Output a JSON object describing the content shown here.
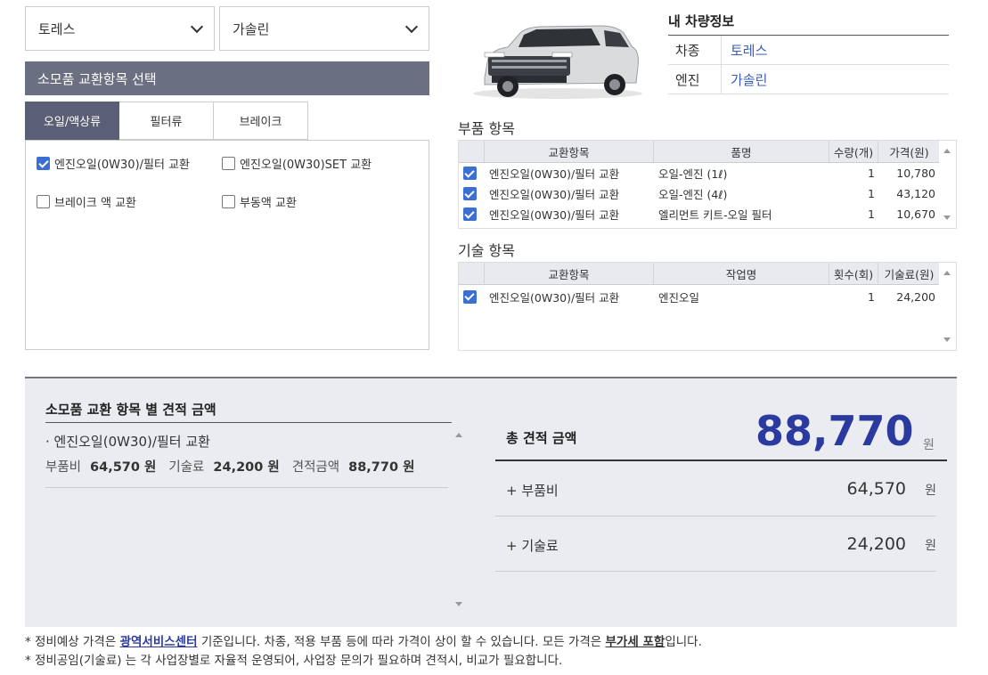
{
  "selects": {
    "car_model": "토레스",
    "fuel": "가솔린"
  },
  "consumables": {
    "header": "소모품 교환항목 선택",
    "tabs": [
      "오일/액상류",
      "필터류",
      "브레이크"
    ],
    "active_tab": 0,
    "options": [
      {
        "label": "엔진오일(0W30)/필터 교환",
        "checked": true
      },
      {
        "label": "엔진오일(0W30)SET 교환",
        "checked": false
      },
      {
        "label": "브레이크 액 교환",
        "checked": false
      },
      {
        "label": "부동액 교환",
        "checked": false
      }
    ]
  },
  "vehicle": {
    "title": "내 차량정보",
    "rows": [
      {
        "key": "차종",
        "value": "토레스"
      },
      {
        "key": "엔진",
        "value": "가솔린"
      }
    ]
  },
  "parts": {
    "title": "부품 항목",
    "headers": [
      "교환항목",
      "품명",
      "수량(개)",
      "가격(원)"
    ],
    "rows": [
      {
        "item": "엔진오일(0W30)/필터 교환",
        "name": "오일-엔진 (1ℓ)",
        "qty": "1",
        "price": "10,780",
        "checked": true
      },
      {
        "item": "엔진오일(0W30)/필터 교환",
        "name": "오일-엔진 (4ℓ)",
        "qty": "1",
        "price": "43,120",
        "checked": true
      },
      {
        "item": "엔진오일(0W30)/필터 교환",
        "name": "엘리먼트 키트-오일 필터",
        "qty": "1",
        "price": "10,670",
        "checked": true
      }
    ]
  },
  "labor": {
    "title": "기술 항목",
    "headers": [
      "교환항목",
      "작업명",
      "횟수(회)",
      "기술료(원)"
    ],
    "rows": [
      {
        "item": "엔진오일(0W30)/필터 교환",
        "name": "엔진오일",
        "qty": "1",
        "price": "24,200",
        "checked": true
      }
    ]
  },
  "estimate": {
    "title": "소모품 교환 항목 별 견적 금액",
    "items": [
      {
        "name": "· 엔진오일(0W30)/필터 교환",
        "parts_label": "부품비",
        "parts_value": "64,570 원",
        "labor_label": "기술료",
        "labor_value": "24,200 원",
        "total_label": "견적금액",
        "total_value": "88,770 원"
      }
    ],
    "total_label": "총 견적 금액",
    "total_value": "88,770",
    "total_unit": "원",
    "sub": [
      {
        "label": "+ 부품비",
        "value": "64,570",
        "unit": "원"
      },
      {
        "label": "+ 기술료",
        "value": "24,200",
        "unit": "원"
      }
    ]
  },
  "notes": {
    "line1_a": "* 정비예상 가격은 ",
    "line1_link": "광역서비스센터",
    "line1_b": " 기준입니다. 차종, 적용 부품 등에 따라 가격이 상이 할 수 있습니다. 모든 가격은 ",
    "line1_bold": "부가세 포함",
    "line1_c": "입니다.",
    "line2": "* 정비공임(기술료) 는 각 사업장별로 자율적 운영되어, 사업장 문의가 필요하며 견적시, 비교가 필요합니다."
  },
  "colors": {
    "accent": "#2b3a9e",
    "header_bg": "#6b6f82",
    "checkbox": "#3b6fd3",
    "panel_bg": "#ebecf1"
  }
}
